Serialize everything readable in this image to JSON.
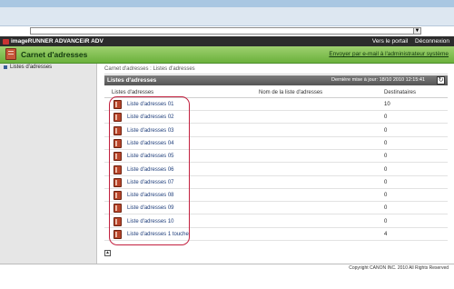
{
  "header": {
    "product": "imageRUNNER ADVANCE",
    "device": "iR ADV",
    "links": [
      "Vers le portail",
      "Déconnexion"
    ]
  },
  "section": {
    "title": "Carnet d'adresses",
    "admin_link": "Envoyer par e-mail à l'administrateur système"
  },
  "sidebar": {
    "items": [
      {
        "label": "Listes d'adresses"
      }
    ]
  },
  "breadcrumb": "Carnet d'adresses : Listes d'adresses",
  "panel": {
    "title": "Listes d'adresses",
    "last_update": "Dernière mise à jour: 18/10 2010 12:15:41"
  },
  "table": {
    "columns": [
      "Listes d'adresses",
      "Nom de la liste d'adresses",
      "Destinataires"
    ],
    "rows": [
      {
        "name": "Liste d'adresses 01",
        "list_name": "",
        "destinations": "10"
      },
      {
        "name": "Liste d'adresses 02",
        "list_name": "",
        "destinations": "0"
      },
      {
        "name": "Liste d'adresses 03",
        "list_name": "",
        "destinations": "0"
      },
      {
        "name": "Liste d'adresses 04",
        "list_name": "",
        "destinations": "0"
      },
      {
        "name": "Liste d'adresses 05",
        "list_name": "",
        "destinations": "0"
      },
      {
        "name": "Liste d'adresses 06",
        "list_name": "",
        "destinations": "0"
      },
      {
        "name": "Liste d'adresses 07",
        "list_name": "",
        "destinations": "0"
      },
      {
        "name": "Liste d'adresses 08",
        "list_name": "",
        "destinations": "0"
      },
      {
        "name": "Liste d'adresses 09",
        "list_name": "",
        "destinations": "0"
      },
      {
        "name": "Liste d'adresses 10",
        "list_name": "",
        "destinations": "0"
      },
      {
        "name": "Liste d'adresses 1 touche",
        "list_name": "",
        "destinations": "4"
      }
    ]
  },
  "footer": {
    "copyright": "Copyright CANON INC. 2010 All Rights Reserved"
  },
  "icons": {
    "address_book": "address-book-icon",
    "refresh": "refresh-icon",
    "scroll_top": "arrow-up-icon",
    "dropdown": "chevron-down-icon"
  },
  "colors": {
    "section_green": "#7cbc4b",
    "product_bar": "#2c2c2c",
    "highlight": "#c3203f"
  }
}
